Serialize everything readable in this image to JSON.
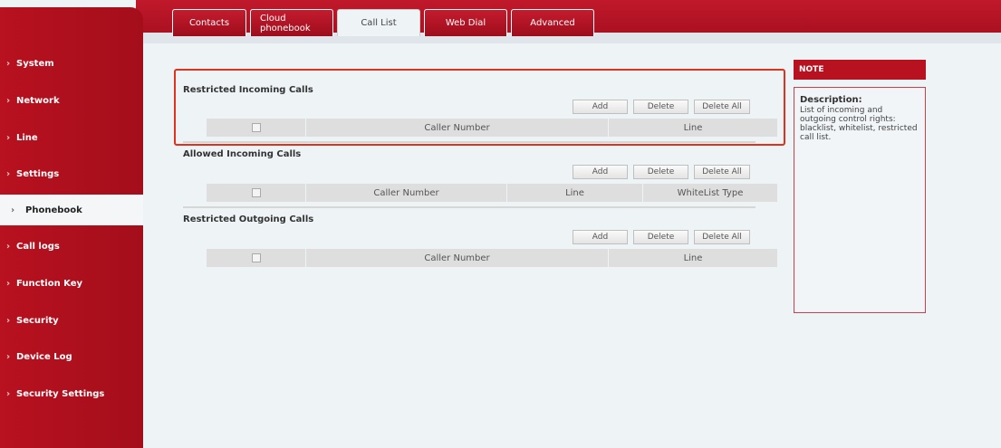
{
  "tabs": [
    {
      "label": "Contacts",
      "active": false
    },
    {
      "label": "Cloud phonebook",
      "active": false
    },
    {
      "label": "Call List",
      "active": true
    },
    {
      "label": "Web Dial",
      "active": false
    },
    {
      "label": "Advanced",
      "active": false
    }
  ],
  "sidebar": {
    "items": [
      {
        "label": "System"
      },
      {
        "label": "Network"
      },
      {
        "label": "Line"
      },
      {
        "label": "Settings"
      },
      {
        "label": "Phonebook",
        "active": true
      },
      {
        "label": "Call logs"
      },
      {
        "label": "Function Key"
      },
      {
        "label": "Security"
      },
      {
        "label": "Device Log"
      },
      {
        "label": "Security Settings"
      }
    ]
  },
  "buttons": {
    "add": "Add",
    "delete": "Delete",
    "delete_all": "Delete All"
  },
  "sections": {
    "restricted_incoming": {
      "title": "Restricted Incoming Calls",
      "columns": [
        "Caller Number",
        "Line"
      ]
    },
    "allowed_incoming": {
      "title": "Allowed Incoming Calls",
      "columns": [
        "Caller Number",
        "Line",
        "WhiteList Type"
      ]
    },
    "restricted_outgoing": {
      "title": "Restricted Outgoing Calls",
      "columns": [
        "Caller Number",
        "Line"
      ]
    }
  },
  "note": {
    "header": "NOTE",
    "title": "Description:",
    "text": "List of incoming and outgoing control rights: blacklist, whitelist, restricted call list."
  },
  "colors": {
    "brand_red": "#b8111f",
    "highlight_border": "#e0301e"
  }
}
